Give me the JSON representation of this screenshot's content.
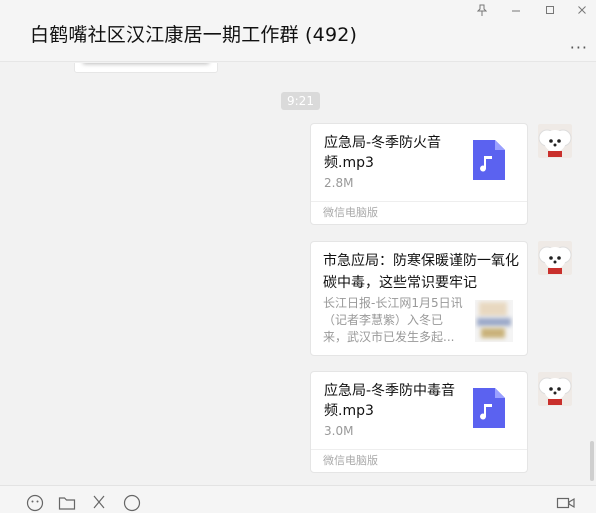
{
  "window": {
    "title": "白鹤嘴社区汉江康居一期工作群 (492)",
    "pin_icon": "pin-icon",
    "minimize_icon": "minimize-icon",
    "maximize_icon": "maximize-icon",
    "close_icon": "close-icon",
    "more_icon": "more-icon",
    "more_label": "···"
  },
  "chat": {
    "timestamp": "9:21",
    "messages": [
      {
        "type": "file",
        "title": "应急局-冬季防火音频.mp3",
        "size": "2.8M",
        "footer": "微信电脑版",
        "icon": "audio-file-icon"
      },
      {
        "type": "article",
        "title": "市急应局：防寒保暖谨防一氧化碳中毒，这些常识要牢记",
        "description": "长江日报-长江网1月5日讯（记者李慧紫）入冬已来，武汉市已发生多起...",
        "thumbnail": "article-thumbnail"
      },
      {
        "type": "file",
        "title": "应急局-冬季防中毒音频.mp3",
        "size": "3.0M",
        "footer": "微信电脑版",
        "icon": "audio-file-icon"
      }
    ]
  },
  "toolbar": {
    "icons": [
      "emoji-icon",
      "folder-icon",
      "scissors-icon",
      "chat-history-icon",
      "video-call-icon"
    ]
  },
  "colors": {
    "file_icon": "#5b62f0",
    "background": "#f2f2f2",
    "bubble": "#ffffff"
  }
}
